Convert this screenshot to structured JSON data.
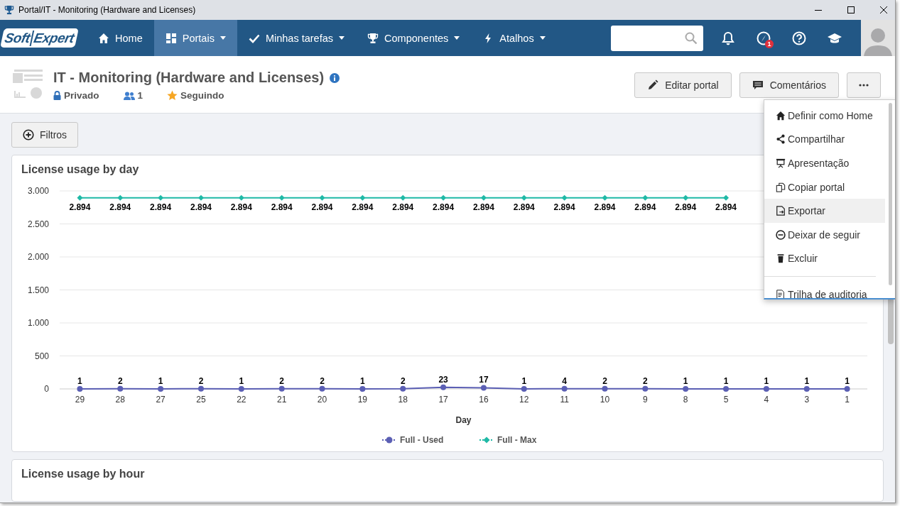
{
  "window": {
    "title": "Portal/IT - Monitoring (Hardware and Licenses)"
  },
  "nav": {
    "logo": {
      "part1": "Soft",
      "part2": "Expert"
    },
    "items": [
      {
        "label": "Home",
        "dropdown": false,
        "selected": false
      },
      {
        "label": "Portais",
        "dropdown": true,
        "selected": true
      },
      {
        "label": "Minhas tarefas",
        "dropdown": true,
        "selected": false
      },
      {
        "label": "Componentes",
        "dropdown": true,
        "selected": false
      },
      {
        "label": "Atalhos",
        "dropdown": true,
        "selected": false
      }
    ],
    "notification_badge": "1"
  },
  "header": {
    "title": "IT - Monitoring (Hardware and Licenses)",
    "privacy": "Privado",
    "members": "1",
    "follow": "Seguindo",
    "buttons": [
      "Editar portal",
      "Comentários"
    ]
  },
  "filters_button": "Filtros",
  "menu": {
    "items": [
      {
        "label": "Definir como Home",
        "highlighted": false
      },
      {
        "label": "Compartilhar",
        "highlighted": false
      },
      {
        "label": "Apresentação",
        "highlighted": false
      },
      {
        "label": "Copiar portal",
        "highlighted": false
      },
      {
        "label": "Exportar",
        "highlighted": true
      },
      {
        "label": "Deixar de seguir",
        "highlighted": false
      },
      {
        "label": "Excluir",
        "highlighted": false
      },
      {
        "label": "Trilha de auditoria",
        "highlighted": false,
        "divider_before": true
      }
    ]
  },
  "cards": [
    {
      "title": "License usage by day",
      "chart_data": {
        "type": "line",
        "xlabel": "Day",
        "categories": [
          "29",
          "28",
          "27",
          "25",
          "22",
          "21",
          "20",
          "19",
          "18",
          "17",
          "16",
          "12",
          "11",
          "10",
          "9",
          "8",
          "5",
          "4",
          "3",
          "1"
        ],
        "series": [
          {
            "name": "Full - Used",
            "color": "#5b5fb4",
            "marker": "circle",
            "values": [
              1,
              2,
              1,
              2,
              1,
              2,
              2,
              1,
              2,
              23,
              17,
              1,
              4,
              2,
              2,
              1,
              1,
              1,
              1,
              1
            ],
            "value_labels": [
              "1",
              "2",
              "1",
              "2",
              "1",
              "2",
              "2",
              "1",
              "2",
              "23",
              "17",
              "1",
              "4",
              "2",
              "2",
              "1",
              "1",
              "1",
              "1",
              "1"
            ]
          },
          {
            "name": "Full - Max",
            "color": "#1fb9a6",
            "marker": "diamond",
            "values": [
              2894,
              2894,
              2894,
              2894,
              2894,
              2894,
              2894,
              2894,
              2894,
              2894,
              2894,
              2894,
              2894,
              2894,
              2894,
              2894,
              2894,
              null,
              null,
              null
            ],
            "value_labels": [
              "2.894",
              "2.894",
              "2.894",
              "2.894",
              "2.894",
              "2.894",
              "2.894",
              "2.894",
              "2.894",
              "2.894",
              "2.894",
              "2.894",
              "2.894",
              "2.894",
              "2.894",
              "2.894",
              "2.894",
              null,
              null,
              null
            ]
          }
        ],
        "ylim": [
          0,
          3000
        ],
        "yticks": [
          {
            "value": 0,
            "label": "0"
          },
          {
            "value": 500,
            "label": "500"
          },
          {
            "value": 1000,
            "label": "1.000"
          },
          {
            "value": 1500,
            "label": "1.500"
          },
          {
            "value": 2000,
            "label": "2.000"
          },
          {
            "value": 2500,
            "label": "2.500"
          },
          {
            "value": 3000,
            "label": "3.000"
          }
        ],
        "grid": true,
        "legend": true
      }
    },
    {
      "title": "License usage by hour"
    }
  ]
}
